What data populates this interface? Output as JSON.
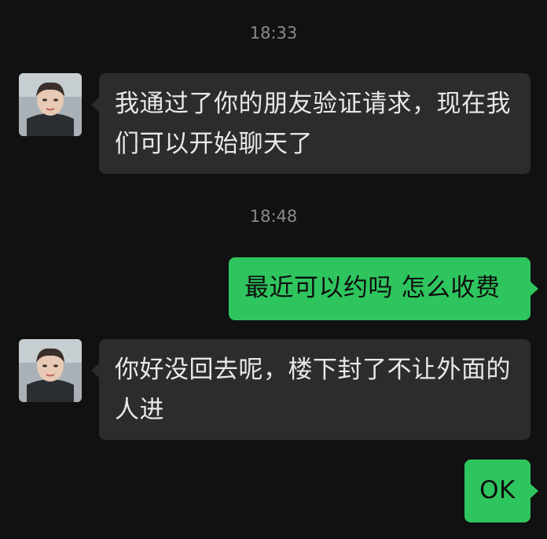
{
  "conversation": {
    "messages": [
      {
        "type": "time",
        "text": "18:33"
      },
      {
        "type": "incoming",
        "text": "我通过了你的朋友验证请求，现在我们可以开始聊天了"
      },
      {
        "type": "time",
        "text": "18:48"
      },
      {
        "type": "outgoing",
        "text": "最近可以约吗 怎么收费"
      },
      {
        "type": "incoming",
        "text": "你好没回去呢，楼下封了不让外面的人进"
      },
      {
        "type": "outgoing",
        "text": "OK"
      }
    ]
  },
  "colors": {
    "background": "#111111",
    "incoming_bubble": "#2c2c2c",
    "outgoing_bubble": "#2fc55e",
    "timestamp_text": "#8a8a8a"
  },
  "icons": {
    "contact_avatar": "contact-avatar-photo"
  }
}
